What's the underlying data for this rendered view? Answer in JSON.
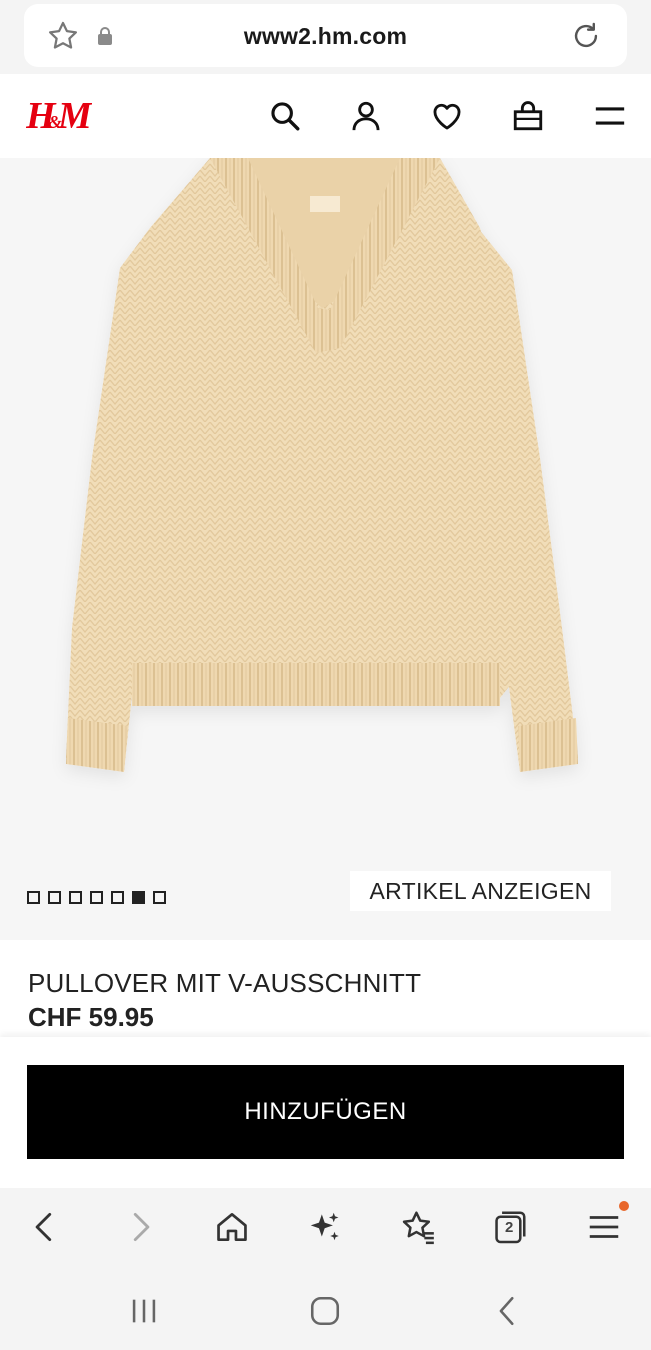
{
  "browser": {
    "url": "www2.hm.com",
    "tab_count": "2"
  },
  "site": {
    "brand": "H&M"
  },
  "gallery": {
    "image_count": 7,
    "active_index": 5,
    "view_button": "ARTIKEL ANZEIGEN"
  },
  "product": {
    "name": "PULLOVER MIT V-AUSSCHNITT",
    "price": "CHF 59.95"
  },
  "cart": {
    "add_label": "HINZUFÜGEN"
  },
  "icons": {
    "header": [
      "search-icon",
      "account-icon",
      "favorites-icon",
      "shopping-bag-icon",
      "menu-icon"
    ],
    "toolbar": [
      "back-icon",
      "forward-icon",
      "home-icon",
      "ai-sparkle-icon",
      "bookmarks-icon",
      "tabs-icon",
      "browser-menu-icon"
    ],
    "navigation": [
      "recent-apps-icon",
      "home-button-icon",
      "nav-back-icon"
    ]
  },
  "colors": {
    "brand_red": "#e50010",
    "sweater": "#f1ddb8",
    "button_bg": "#000000",
    "notification": "#e8672b"
  }
}
